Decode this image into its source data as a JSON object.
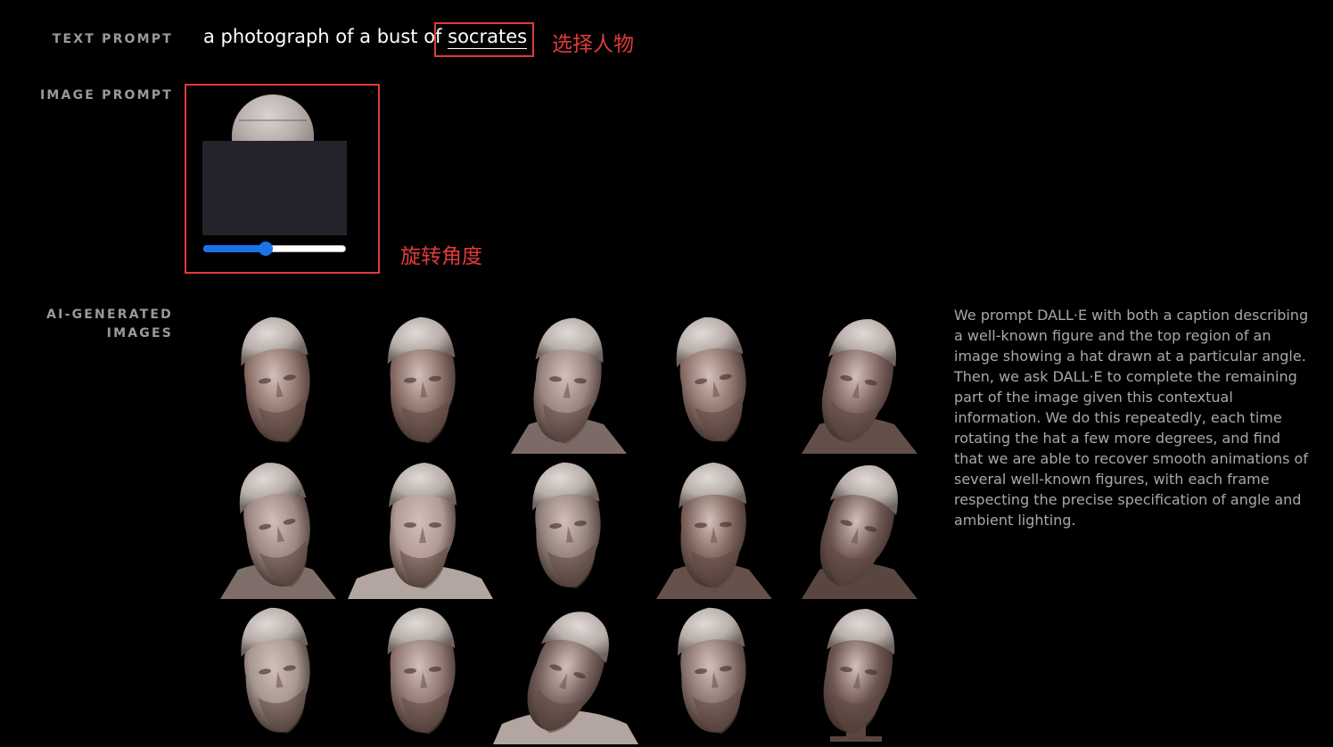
{
  "labels": {
    "text_prompt": "TEXT PROMPT",
    "image_prompt": "IMAGE PROMPT",
    "ai_generated_line1": "AI-GENERATED",
    "ai_generated_line2": "IMAGES"
  },
  "text_prompt": {
    "prefix": "a photograph of a bust of ",
    "subject": "socrates"
  },
  "annotations": {
    "select_subject": "选择人物",
    "rotate_angle": "旋转角度",
    "color": "#e03a3a"
  },
  "slider": {
    "value_fraction": 0.44,
    "accent": "#1a73e8"
  },
  "description": "We prompt DALL·E with both a caption describing a well-known figure and the top region of an image showing a hat drawn at a particular angle. Then, we ask DALL·E to complete the remaining part of the image given this contextual information. We do this repeatedly, each time rotating the hat a few more degrees, and find that we are able to recover smooth animations of several well-known figures, with each frame respecting the precise specification of angle and ambient lighting.",
  "images": {
    "count": 15,
    "rows": 3,
    "columns": 5
  }
}
